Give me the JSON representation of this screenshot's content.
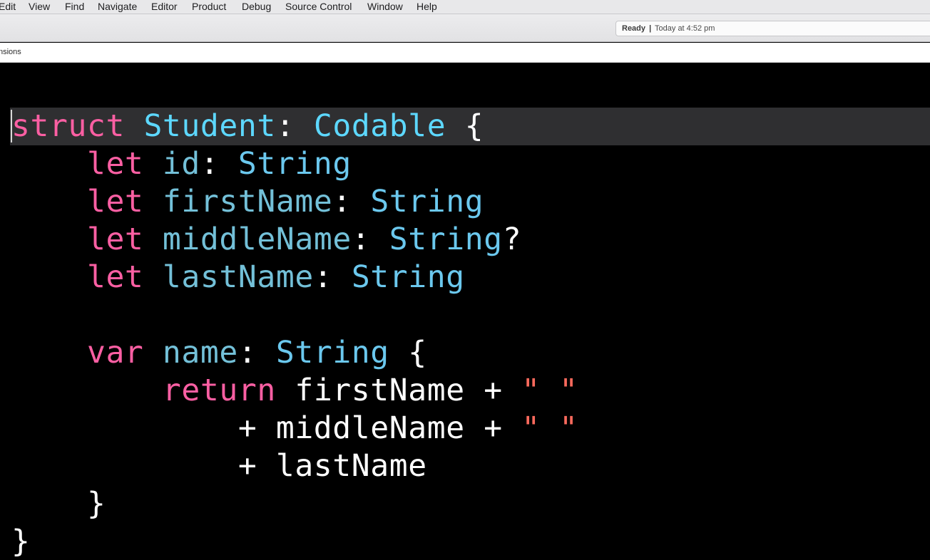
{
  "menubar": {
    "items": [
      "Edit",
      "View",
      "Find",
      "Navigate",
      "Editor",
      "Product",
      "Debug",
      "Source Control",
      "Window",
      "Help"
    ]
  },
  "activity_view": {
    "status": "Ready",
    "separator": "|",
    "timestamp": "Today at 4:52 pm"
  },
  "jumpbar": {
    "crumb": "nsions"
  },
  "colors": {
    "keyword": "#fc5fa3",
    "type_declaration": "#5dd8ff",
    "type_reference": "#6bc8ee",
    "property": "#73c0d8",
    "string": "#fc6a5d",
    "plain": "#ffffff",
    "background": "#000000",
    "current_line": "#2f2f31"
  },
  "editor": {
    "current_line_index": 0,
    "lines": [
      [
        [
          "kw",
          "struct"
        ],
        [
          "plain",
          " "
        ],
        [
          "type",
          "Student"
        ],
        [
          "plain",
          ": "
        ],
        [
          "type",
          "Codable"
        ],
        [
          "plain",
          " {"
        ]
      ],
      [
        [
          "plain",
          "    "
        ],
        [
          "kw",
          "let"
        ],
        [
          "plain",
          " "
        ],
        [
          "prop",
          "id"
        ],
        [
          "plain",
          ": "
        ],
        [
          "typeref",
          "String"
        ]
      ],
      [
        [
          "plain",
          "    "
        ],
        [
          "kw",
          "let"
        ],
        [
          "plain",
          " "
        ],
        [
          "prop",
          "firstName"
        ],
        [
          "plain",
          ": "
        ],
        [
          "typeref",
          "String"
        ]
      ],
      [
        [
          "plain",
          "    "
        ],
        [
          "kw",
          "let"
        ],
        [
          "plain",
          " "
        ],
        [
          "prop",
          "middleName"
        ],
        [
          "plain",
          ": "
        ],
        [
          "typeref",
          "String"
        ],
        [
          "plain",
          "?"
        ]
      ],
      [
        [
          "plain",
          "    "
        ],
        [
          "kw",
          "let"
        ],
        [
          "plain",
          " "
        ],
        [
          "prop",
          "lastName"
        ],
        [
          "plain",
          ": "
        ],
        [
          "typeref",
          "String"
        ]
      ],
      [],
      [
        [
          "plain",
          "    "
        ],
        [
          "kw",
          "var"
        ],
        [
          "plain",
          " "
        ],
        [
          "prop",
          "name"
        ],
        [
          "plain",
          ": "
        ],
        [
          "typeref",
          "String"
        ],
        [
          "plain",
          " {"
        ]
      ],
      [
        [
          "plain",
          "        "
        ],
        [
          "kw",
          "return"
        ],
        [
          "plain",
          " firstName + "
        ],
        [
          "str",
          "\" \""
        ]
      ],
      [
        [
          "plain",
          "            + middleName + "
        ],
        [
          "str",
          "\" \""
        ]
      ],
      [
        [
          "plain",
          "            + lastName"
        ]
      ],
      [
        [
          "plain",
          "    }"
        ]
      ],
      [
        [
          "plain",
          "}"
        ]
      ]
    ]
  }
}
